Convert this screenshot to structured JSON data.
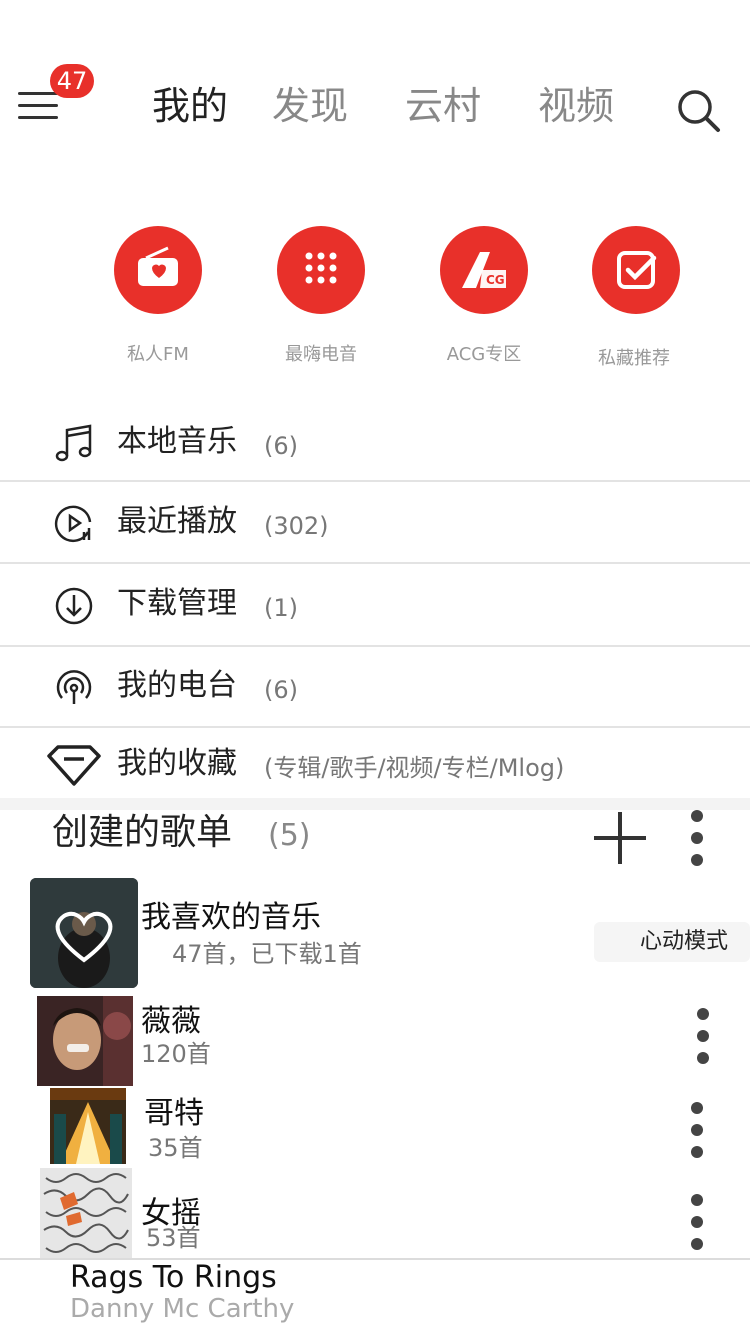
{
  "header": {
    "badge": "47",
    "tabs": [
      "我的",
      "发现",
      "云村",
      "视频"
    ]
  },
  "entries": [
    {
      "label": "私人FM",
      "icon": "radio-icon",
      "color": "#e8302a"
    },
    {
      "label": "最嗨电音",
      "icon": "dots-grid-icon",
      "color": "#e8302a"
    },
    {
      "label": "ACG专区",
      "icon": "acg-icon",
      "color": "#e8302a"
    },
    {
      "label": "私藏推荐",
      "icon": "check-box-icon",
      "color": "#e8302a"
    }
  ],
  "menu": [
    {
      "title": "本地音乐",
      "count": "(6)",
      "icon": "music-note-icon"
    },
    {
      "title": "最近播放",
      "count": "(302)",
      "icon": "recent-play-icon"
    },
    {
      "title": "下载管理",
      "count": "(1)",
      "icon": "download-icon"
    },
    {
      "title": "我的电台",
      "count": "(6)",
      "icon": "podcast-icon"
    },
    {
      "title": "我的收藏",
      "count": "(专辑/歌手/视频/专栏/Mlog)",
      "icon": "diamond-icon"
    }
  ],
  "playlists_section": {
    "title": "创建的歌单",
    "count": "(5)"
  },
  "playlists": [
    {
      "name": "我喜欢的音乐",
      "sub": "47首，已下载1首",
      "action": "心动模式"
    },
    {
      "name": "薇薇",
      "sub": "120首"
    },
    {
      "name": "哥特",
      "sub": "35首"
    },
    {
      "name": "女摇",
      "sub": "53首"
    }
  ],
  "player": {
    "title": "Rags To Rings",
    "artist": "Danny Mc Carthy"
  },
  "colors": {
    "accent": "#e8302a"
  }
}
